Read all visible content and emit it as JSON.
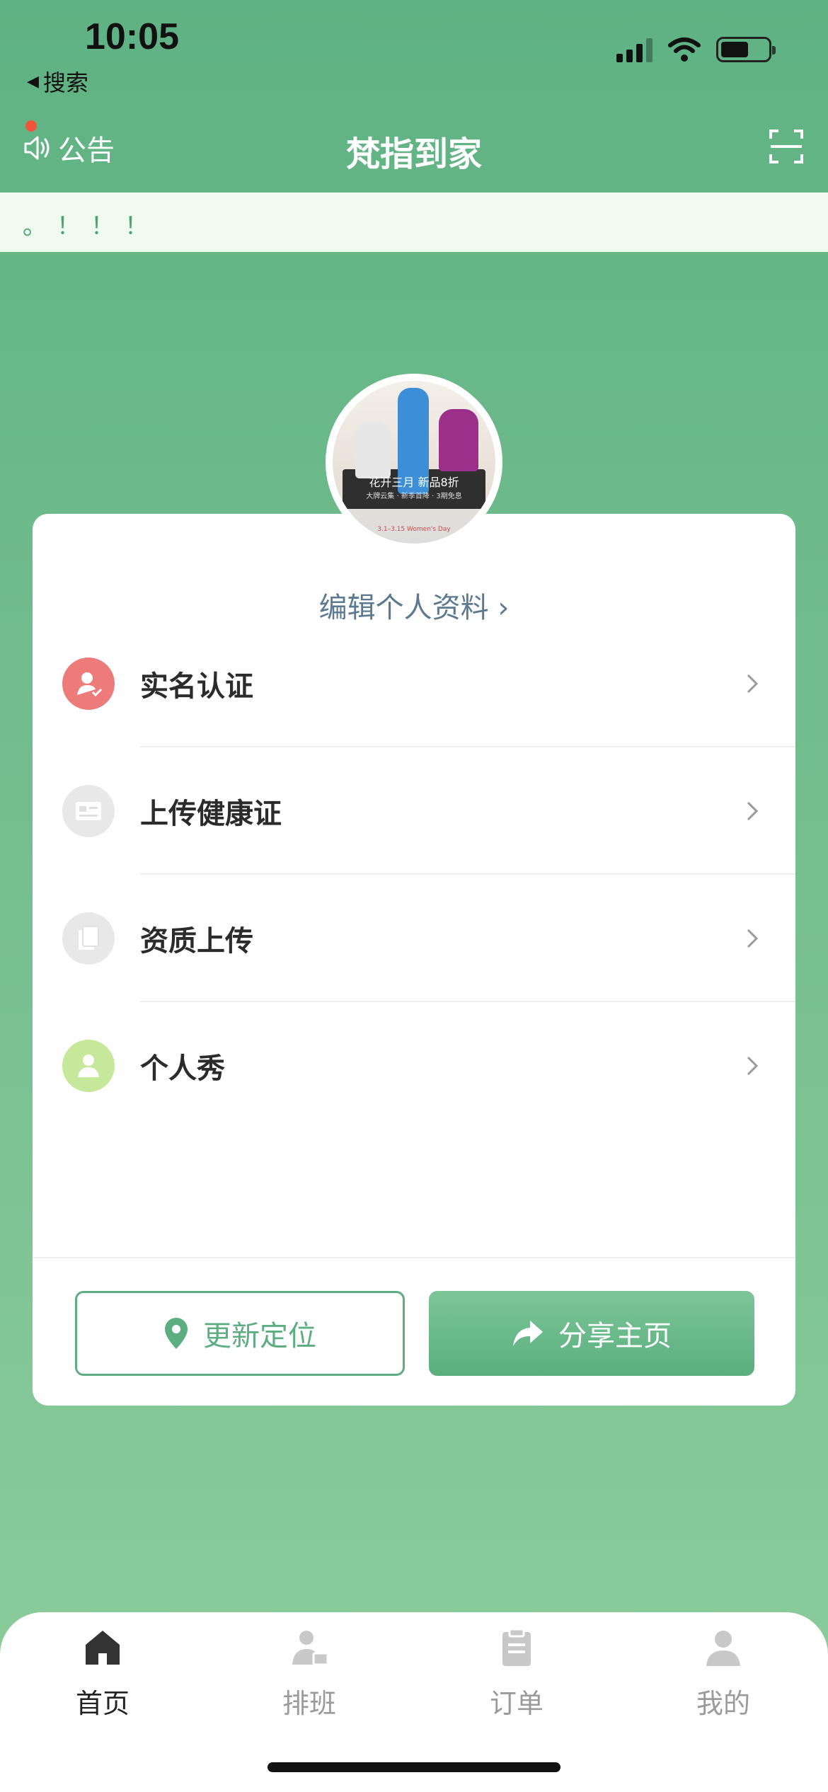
{
  "status_bar": {
    "time": "10:05",
    "back_label": "搜索"
  },
  "nav": {
    "notice_label": "公告",
    "title": "梵指到家"
  },
  "marquee": {
    "text": "。！！！"
  },
  "profile": {
    "avatar_promo": "花开三月 新品8折",
    "avatar_promo_sub": "大牌云集 · 新季首降 · 3期免息",
    "avatar_date": "3.1–3.15 Women's Day",
    "edit_label": "编辑个人资料 ›"
  },
  "menu": [
    {
      "label": "实名认证",
      "icon": "id-verify-icon",
      "color": "#ec7b7a"
    },
    {
      "label": "上传健康证",
      "icon": "health-card-icon",
      "color": "#e8e8e8"
    },
    {
      "label": "资质上传",
      "icon": "document-icon",
      "color": "#e8e8e8"
    },
    {
      "label": "个人秀",
      "icon": "person-icon",
      "color": "#c5e89a"
    }
  ],
  "actions": {
    "update_location": "更新定位",
    "share_homepage": "分享主页"
  },
  "tabbar": [
    {
      "label": "首页",
      "icon": "home-icon",
      "active": true
    },
    {
      "label": "排班",
      "icon": "schedule-icon",
      "active": false
    },
    {
      "label": "订单",
      "icon": "clipboard-icon",
      "active": false
    },
    {
      "label": "我的",
      "icon": "user-icon",
      "active": false
    }
  ],
  "colors": {
    "primary": "#5fb283",
    "accent_text": "#5b7a91",
    "notice_dot": "#f0553b"
  }
}
